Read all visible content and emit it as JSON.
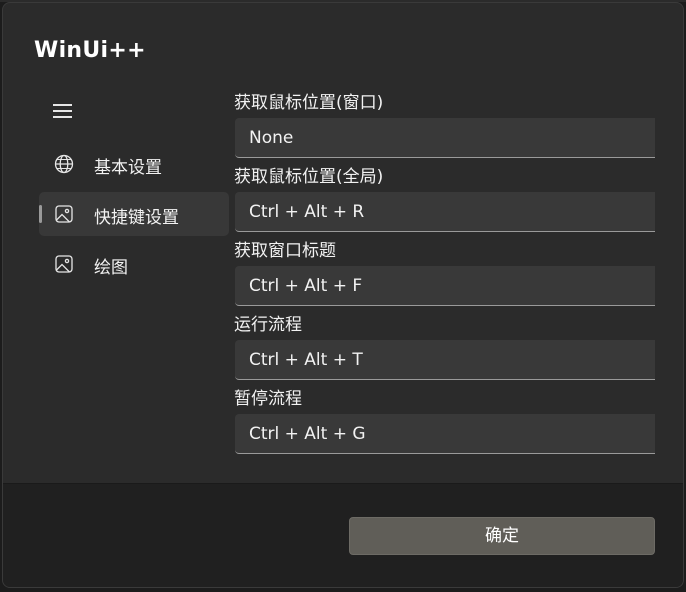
{
  "app": {
    "title": "WinUi++"
  },
  "nav": {
    "menu_icon": "hamburger-menu-icon",
    "items": [
      {
        "label": "基本设置",
        "icon": "globe-icon",
        "selected": false
      },
      {
        "label": "快捷键设置",
        "icon": "image-icon",
        "selected": true
      },
      {
        "label": "绘图",
        "icon": "image-icon",
        "selected": false
      }
    ]
  },
  "fields": [
    {
      "label": "获取鼠标位置(窗口)",
      "value": "None"
    },
    {
      "label": "获取鼠标位置(全局)",
      "value": "Ctrl + Alt + R"
    },
    {
      "label": "获取窗口标题",
      "value": "Ctrl + Alt + F"
    },
    {
      "label": "运行流程",
      "value": "Ctrl + Alt + T"
    },
    {
      "label": "暂停流程",
      "value": "Ctrl + Alt + G"
    }
  ],
  "footer": {
    "ok_label": "确定"
  },
  "colors": {
    "dialog_background": "#2b2b2b",
    "footer_background": "#202020",
    "input_background": "#393939",
    "button_background": "#605e58"
  }
}
